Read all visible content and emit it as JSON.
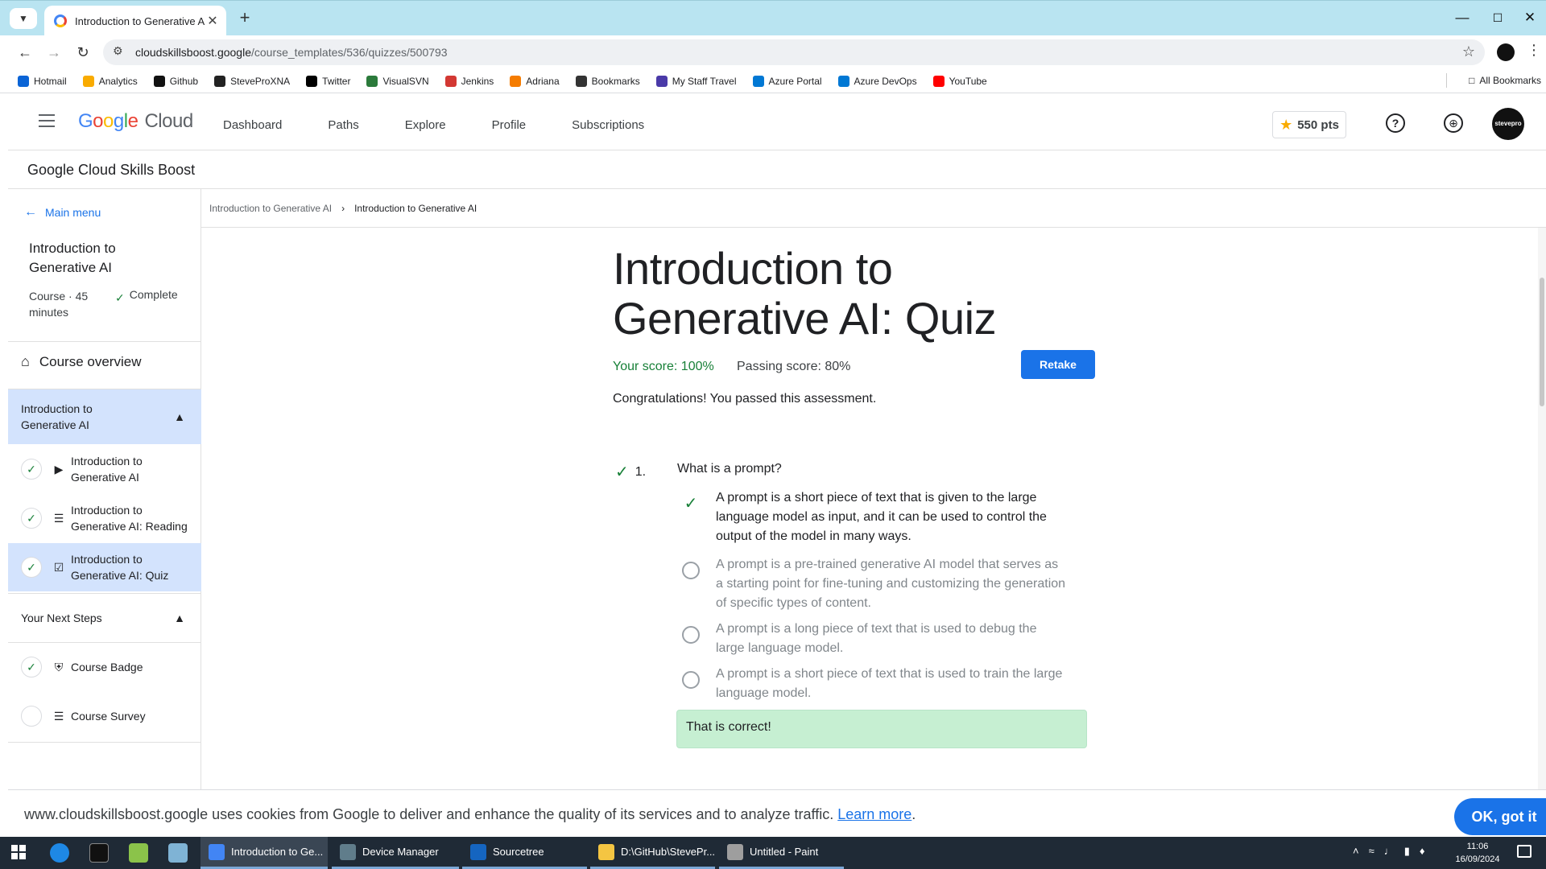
{
  "browser": {
    "tab_title": "Introduction to Generative AI: C",
    "url_host": "cloudskillsboost.google",
    "url_path": "/course_templates/536/quizzes/500793",
    "bookmarks": [
      {
        "label": "Hotmail",
        "color": "#0a64d6"
      },
      {
        "label": "Analytics",
        "color": "#f9ab00"
      },
      {
        "label": "Github",
        "color": "#111111"
      },
      {
        "label": "SteveProXNA",
        "color": "#222222"
      },
      {
        "label": "Twitter",
        "color": "#000000"
      },
      {
        "label": "VisualSVN",
        "color": "#2b7a3b"
      },
      {
        "label": "Jenkins",
        "color": "#d33833"
      },
      {
        "label": "Adriana",
        "color": "#f57c00"
      },
      {
        "label": "Bookmarks",
        "color": "#333333"
      },
      {
        "label": "My Staff Travel",
        "color": "#4a3aa8"
      },
      {
        "label": "Azure Portal",
        "color": "#0078d4"
      },
      {
        "label": "Azure DevOps",
        "color": "#0078d4"
      },
      {
        "label": "YouTube",
        "color": "#ff0000"
      }
    ],
    "all_bookmarks": "All Bookmarks"
  },
  "header": {
    "logo_google": "Google",
    "logo_cloud": "Cloud",
    "nav": [
      "Dashboard",
      "Paths",
      "Explore",
      "Profile",
      "Subscriptions"
    ],
    "points": "550 pts",
    "site_title": "Google Cloud Skills Boost",
    "avatar_text": "stevepro studios"
  },
  "sidebar": {
    "main_menu": "Main menu",
    "course_title": "Introduction to Generative AI",
    "course_meta": "Course · 45 minutes",
    "course_status": "Complete",
    "overview": "Course overview",
    "section1": "Introduction to Generative AI",
    "items": [
      {
        "label": "Introduction to Generative AI",
        "icon": "play-icon",
        "done": true
      },
      {
        "label": "Introduction to Generative AI: Reading",
        "icon": "document-icon",
        "done": true
      },
      {
        "label": "Introduction to Generative AI: Quiz",
        "icon": "quiz-icon",
        "done": true
      }
    ],
    "section2": "Your Next Steps",
    "next_items": [
      {
        "label": "Course Badge",
        "icon": "badge-icon",
        "done": true
      },
      {
        "label": "Course Survey",
        "icon": "document-icon",
        "done": false
      }
    ]
  },
  "main": {
    "breadcrumb": [
      "Introduction to Generative AI",
      "Introduction to Generative AI"
    ],
    "title": "Introduction to Generative AI: Quiz",
    "your_score": "Your score: 100%",
    "passing_score": "Passing score: 80%",
    "retake": "Retake",
    "congrats": "Congratulations! You passed this assessment.",
    "question": {
      "number": "1.",
      "text": "What is a prompt?",
      "options": [
        "A prompt is a short piece of text that is given to the large language model as input, and it can be used to control the output of the model in many ways.",
        "A prompt is a pre-trained generative AI model that serves as a starting point for fine-tuning and customizing the generation of specific types of content.",
        "A prompt is a long piece of text that is used to debug the large language model.",
        "A prompt is a short piece of text that is used to train the large language model."
      ],
      "selected_index": 0,
      "feedback": "That is correct!"
    }
  },
  "cookie": {
    "text": "www.cloudskillsboost.google uses cookies from Google to deliver and enhance the quality of its services and to analyze traffic.",
    "learn_more": "Learn more",
    "ok": "OK, got it"
  },
  "taskbar": {
    "apps": [
      "Introduction to Ge...",
      "Device Manager",
      "Sourcetree",
      "D:\\GitHub\\StevePr...",
      "Untitled - Paint"
    ],
    "time": "11:06",
    "date": "16/09/2024"
  },
  "colors": {
    "accent": "#1a73e8",
    "success": "#188038",
    "feedback_bg": "#c6efd2"
  }
}
